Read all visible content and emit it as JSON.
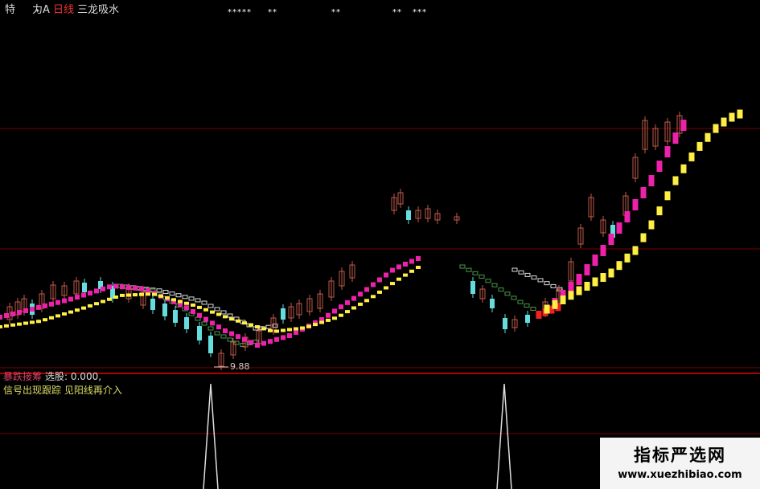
{
  "header": {
    "item1": "特",
    "item2": "力A",
    "period": "日线",
    "indicator_name": "三龙吸水"
  },
  "signal_marks": [
    "*",
    "*****",
    "**",
    "**",
    "**",
    "***"
  ],
  "main_chart": {
    "low_label": "9.88"
  },
  "sub_panel": {
    "indicator_name": "暴跌接筹",
    "select_value": "选股: 0.000,",
    "note": "信号出现跟踪  见阳线再介入"
  },
  "watermark": {
    "title": "指标严选网",
    "url": "www.xuezhibiao.com"
  },
  "colors": {
    "background": "#000000",
    "grid_red": "#8b0000",
    "up_candle": "#c05a4a",
    "down_candle": "#66dddd",
    "green_dots": "#4a9a4a",
    "white_dots": "#dddddd",
    "magenta_line": "#ee22aa",
    "yellow_line": "#ffee44",
    "red_line": "#ee2222",
    "label_yellow": "#dddd66",
    "label_pink": "#dd4466"
  }
}
